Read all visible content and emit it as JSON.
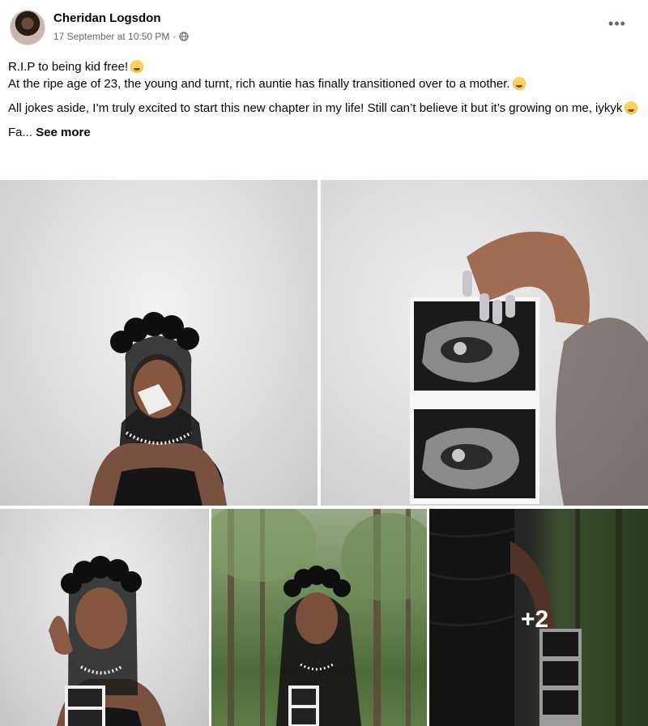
{
  "post": {
    "author": "Cheridan Logsdon",
    "timestamp": "17 September at 10:50 PM",
    "separator": "·",
    "privacy_icon": "globe-icon",
    "more_icon": "more-options-icon",
    "more_label": "•••"
  },
  "body": {
    "line1": "R.I.P to being kid free!",
    "line2": "At the ripe age of 23, the young and turnt, rich auntie has finally transitioned over to a mother.",
    "paragraph2": "All jokes aside, I’m truly excited to start this new chapter in my life! Still can’t believe it but it’s growing on me, iykyk",
    "truncated": "Fa...",
    "see_more": "See more"
  },
  "gallery": {
    "photos": [
      {
        "name": "photo-woman-crying-veil"
      },
      {
        "name": "photo-holding-ultrasound"
      },
      {
        "name": "photo-woman-with-ultrasound"
      },
      {
        "name": "photo-woman-veil-forest"
      },
      {
        "name": "photo-ultrasound-forest"
      }
    ],
    "more_count": "+2"
  },
  "colors": {
    "text_primary": "#050505",
    "text_secondary": "#65676b",
    "background": "#ffffff"
  }
}
